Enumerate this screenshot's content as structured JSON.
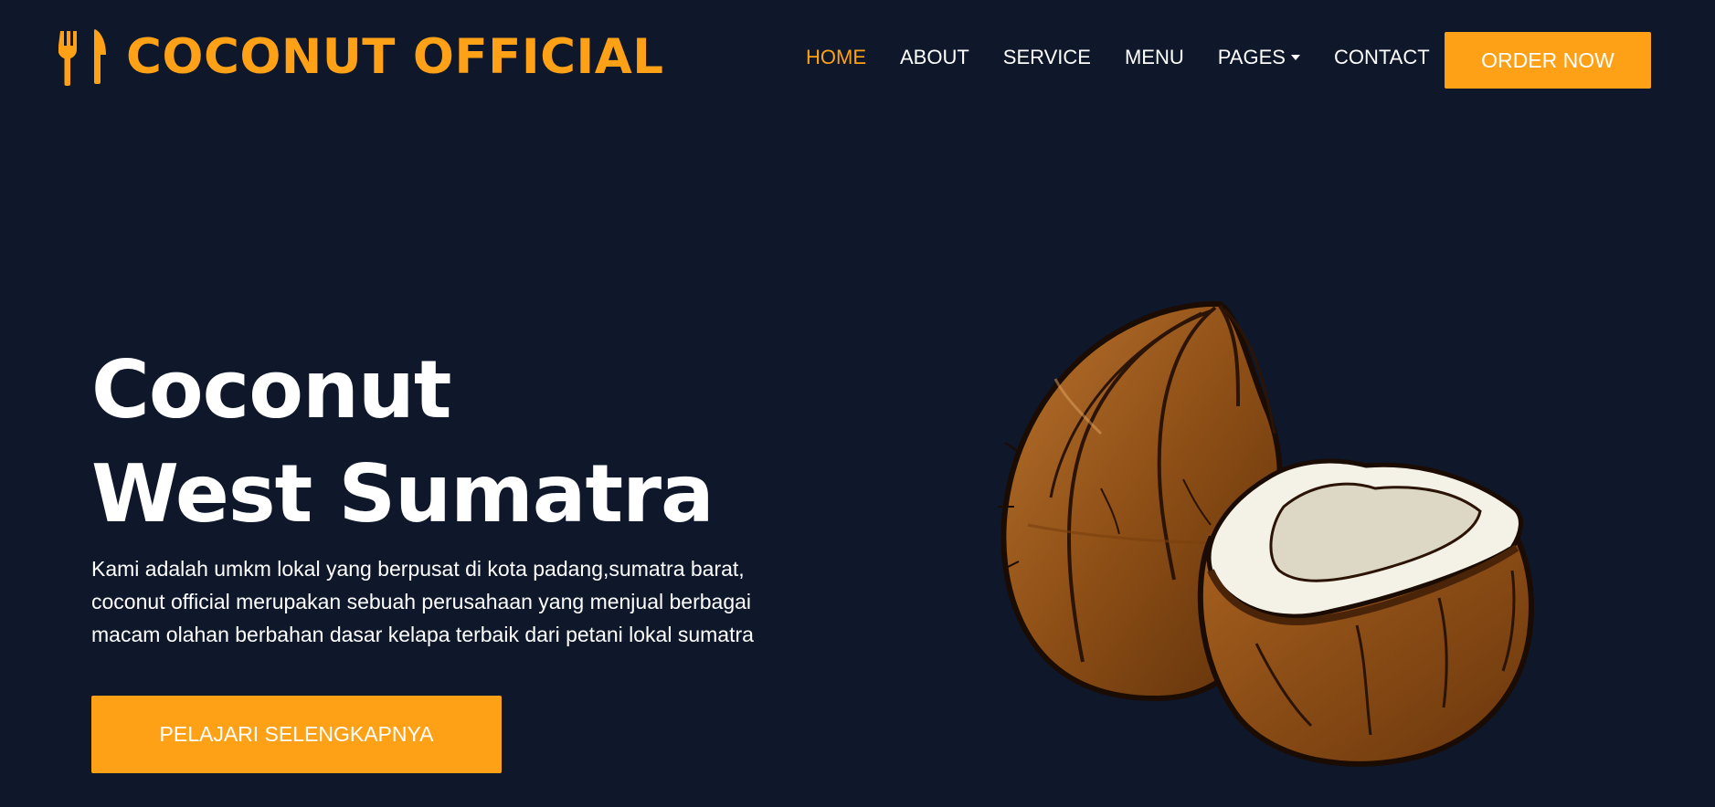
{
  "brand": {
    "name": "COCONUT OFFICIAL",
    "icon": "fork-knife-icon"
  },
  "nav": {
    "items": [
      {
        "label": "HOME",
        "active": true
      },
      {
        "label": "ABOUT",
        "active": false
      },
      {
        "label": "SERVICE",
        "active": false
      },
      {
        "label": "MENU",
        "active": false
      },
      {
        "label": "PAGES",
        "active": false,
        "dropdown": true
      },
      {
        "label": "CONTACT",
        "active": false
      }
    ],
    "cta_label": "ORDER NOW"
  },
  "hero": {
    "title_line1": "Coconut",
    "title_line2": "West Sumatra",
    "description": "Kami adalah umkm lokal yang berpusat di kota padang,sumatra barat, coconut official merupakan sebuah perusahaan yang menjual berbagai macam olahan berbahan dasar kelapa terbaik dari petani lokal sumatra",
    "button_label": "PELAJARI SELENGKAPNYA",
    "image": "coconut-illustration"
  },
  "colors": {
    "background": "#0f172b",
    "accent": "#fea116",
    "text": "#ffffff"
  }
}
